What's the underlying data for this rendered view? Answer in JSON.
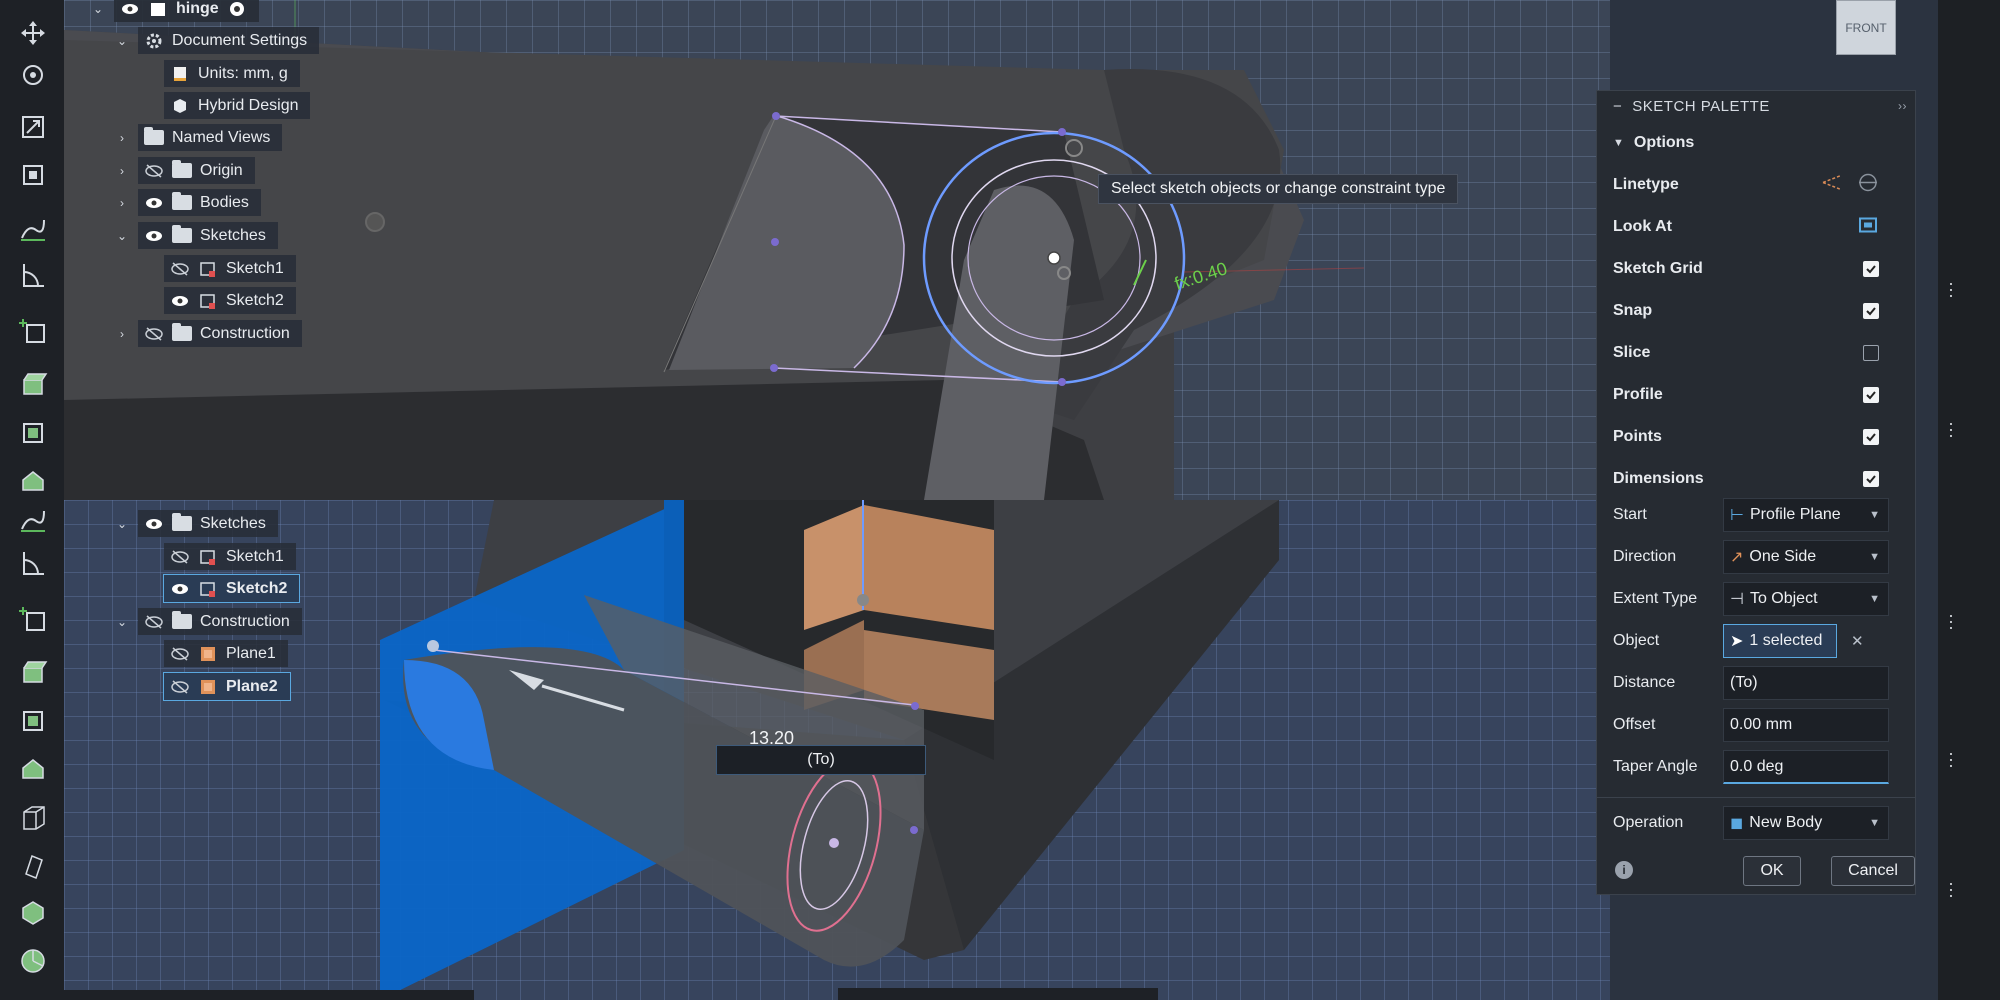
{
  "browser_top": {
    "root_label": "hinge",
    "items": [
      {
        "label": "Document Settings",
        "icon": "gear-icon",
        "expanded": true
      },
      {
        "label": "Units: mm, g",
        "icon": "units-doc-icon"
      },
      {
        "label": "Hybrid Design",
        "icon": "cube-icon"
      },
      {
        "label": "Named Views",
        "icon": "folder-icon"
      },
      {
        "label": "Origin",
        "icon": "folder-icon"
      },
      {
        "label": "Bodies",
        "icon": "folder-icon"
      },
      {
        "label": "Sketches",
        "icon": "folder-icon"
      },
      {
        "label": "Sketch1",
        "icon": "sketch-icon"
      },
      {
        "label": "Sketch2",
        "icon": "sketch-icon"
      },
      {
        "label": "Construction",
        "icon": "folder-icon"
      }
    ]
  },
  "browser_bottom": {
    "items": [
      {
        "label": "Sketches"
      },
      {
        "label": "Sketch1"
      },
      {
        "label": "Sketch2"
      },
      {
        "label": "Construction"
      },
      {
        "label": "Plane1"
      },
      {
        "label": "Plane2"
      }
    ]
  },
  "tooltip": "Select sketch objects or change constraint type",
  "viewcube_label": "FRONT",
  "sketch_palette": {
    "title": "SKETCH PALETTE",
    "section": "Options",
    "rows": [
      {
        "label": "Linetype",
        "kind": "icons"
      },
      {
        "label": "Look At",
        "kind": "icon"
      },
      {
        "label": "Sketch Grid",
        "checked": true
      },
      {
        "label": "Snap",
        "checked": true
      },
      {
        "label": "Slice",
        "checked": false
      },
      {
        "label": "Profile",
        "checked": true
      },
      {
        "label": "Points",
        "checked": true
      },
      {
        "label": "Dimensions",
        "checked": true
      }
    ]
  },
  "extrude": {
    "start_label": "Start",
    "start_value": "Profile Plane",
    "direction_label": "Direction",
    "direction_value": "One Side",
    "extent_label": "Extent Type",
    "extent_value": "To Object",
    "object_label": "Object",
    "object_value": "1 selected",
    "distance_label": "Distance",
    "distance_value": "(To)",
    "offset_label": "Offset",
    "offset_value": "0.00 mm",
    "taper_label": "Taper Angle",
    "taper_value": "0.0 deg",
    "operation_label": "Operation",
    "operation_value": "New Body",
    "ok_label": "OK",
    "cancel_label": "Cancel"
  },
  "dimension": {
    "value_label": "13.20",
    "input_value": "(To)",
    "sketch_dim": "0.40",
    "fx_prefix": "fx:"
  },
  "colors": {
    "accent": "#5aa8e0",
    "plane_blue": "#0a66c8",
    "dim_green": "#6cd04a",
    "sketch_circle": "#6e9bff"
  }
}
